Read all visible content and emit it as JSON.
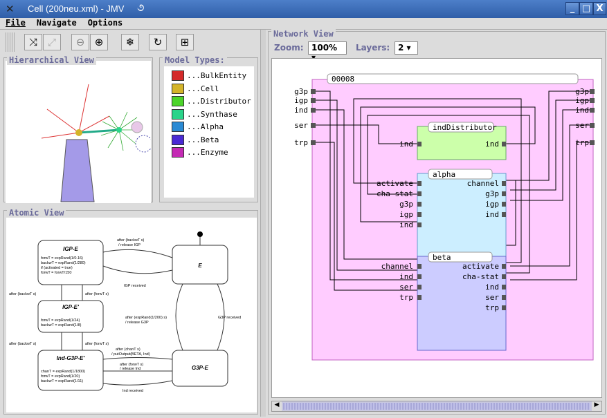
{
  "window": {
    "title": "Cell (200neu.xml) - JMV",
    "minimize": "_",
    "maximize": "□",
    "close": "X"
  },
  "menu": {
    "file": "File",
    "navigate": "Navigate",
    "options": "Options"
  },
  "hier": {
    "title": "Hierarchical View"
  },
  "legend": {
    "title": "Model Types:",
    "items": [
      {
        "label": "...BulkEntity",
        "color": "#d42a2a"
      },
      {
        "label": "...Cell",
        "color": "#d4b42a"
      },
      {
        "label": "...Distributor",
        "color": "#4cd42a"
      },
      {
        "label": "...Synthase",
        "color": "#2ad48a"
      },
      {
        "label": "...Alpha",
        "color": "#2a8ad4"
      },
      {
        "label": "...Beta",
        "color": "#4a2ad4"
      },
      {
        "label": "...Enzyme",
        "color": "#c42ab4"
      }
    ]
  },
  "atomic": {
    "title": "Atomic View",
    "states": {
      "igpe": "IGP-E",
      "igpe2": "IGP-E'",
      "indg3p": "Ind-G3P-E'",
      "e": "E",
      "g3pe": "G3P-E"
    },
    "igpe_body": [
      "forwT = expRand(1/0.16)",
      "backwT = expRand(1/280)",
      "if (activated = true)",
      "forwT = forwT/150"
    ],
    "igpe2_body": [
      "forwT = expRand(1/24)",
      "backwT = expRand(1/8)"
    ],
    "indg3p_body": [
      "chanT = expRand(1/1800)",
      "forwT = expRand(1/20)",
      "backwT = expRand(1/11)"
    ],
    "labels": {
      "l1": "after (backwT s)",
      "l2": "/ release IGP",
      "l3": "IGP received",
      "l4": "after (backwT s)",
      "l5": "after (forwT s)",
      "l6": "after (backwT s)",
      "l7": "after (forwT s)",
      "l8": "after (chanT s)",
      "l9": "/ putOutput(BETA, Ind)",
      "l10": "after (forwT s)",
      "l11": "/ release Ind",
      "l12": "Ind received",
      "l13": "after (expRand(1/200) s)",
      "l14": "/ release G3P",
      "l15": "G3P received"
    }
  },
  "network": {
    "title": "Network View",
    "zoom_label": "Zoom:",
    "zoom_value": "100%",
    "layers_label": "Layers:",
    "layers_value": "2",
    "outer": {
      "name": "00008",
      "inputs": [
        "g3p",
        "igp",
        "ind",
        "ser",
        "trp"
      ],
      "outputs": [
        "g3p",
        "igp",
        "ind",
        "ser",
        "trp"
      ]
    },
    "dist": {
      "name": "indDistributor",
      "in": "ind",
      "out": "ind"
    },
    "alpha": {
      "name": "alpha",
      "inputs": [
        "activate",
        "cha-stat",
        "g3p",
        "igp",
        "ind"
      ],
      "outputs": [
        "channel",
        "g3p",
        "igp",
        "ind"
      ]
    },
    "beta": {
      "name": "beta",
      "inputs": [
        "channel",
        "ind",
        "ser",
        "trp"
      ],
      "outputs": [
        "activate",
        "cha-stat",
        "ind",
        "ser",
        "trp"
      ]
    }
  }
}
